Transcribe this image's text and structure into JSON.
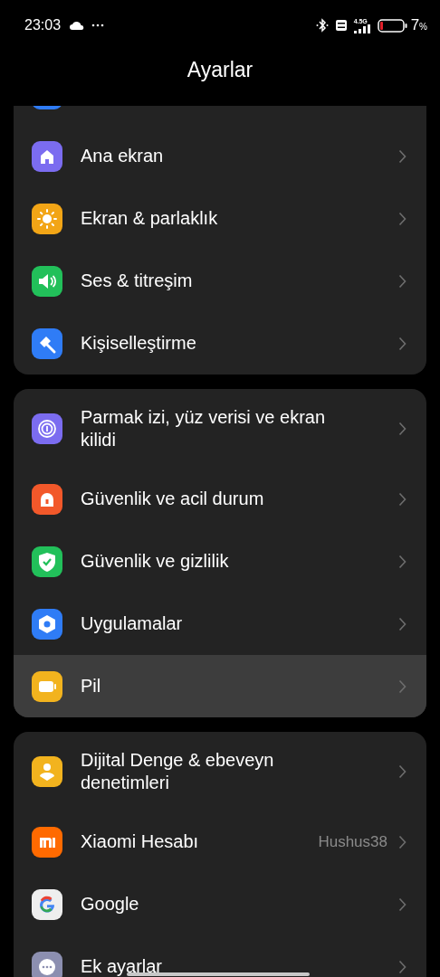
{
  "status_bar": {
    "time": "23:03",
    "network": "4.5G",
    "battery_percent": "7",
    "percent_sign": "%"
  },
  "title": "Ayarlar",
  "sections": [
    {
      "items": [
        {
          "label": "Ana ekran",
          "selected": false
        },
        {
          "label": "Ekran & parlaklık",
          "selected": false
        },
        {
          "label": "Ses & titreşim",
          "selected": false
        },
        {
          "label": "Kişiselleştirme",
          "selected": false
        }
      ]
    },
    {
      "items": [
        {
          "label": "Parmak izi, yüz verisi ve ekran kilidi",
          "selected": false
        },
        {
          "label": "Güvenlik ve acil durum",
          "selected": false
        },
        {
          "label": "Güvenlik ve gizlilik",
          "selected": false
        },
        {
          "label": "Uygulamalar",
          "selected": false
        },
        {
          "label": "Pil",
          "selected": true
        }
      ]
    },
    {
      "items": [
        {
          "label": "Dijital Denge & ebeveyn denetimleri",
          "selected": false
        },
        {
          "label": "Xiaomi Hesabı",
          "value": "Hushus38",
          "selected": false
        },
        {
          "label": "Google",
          "selected": false
        },
        {
          "label": "Ek ayarlar",
          "selected": false
        }
      ]
    }
  ]
}
